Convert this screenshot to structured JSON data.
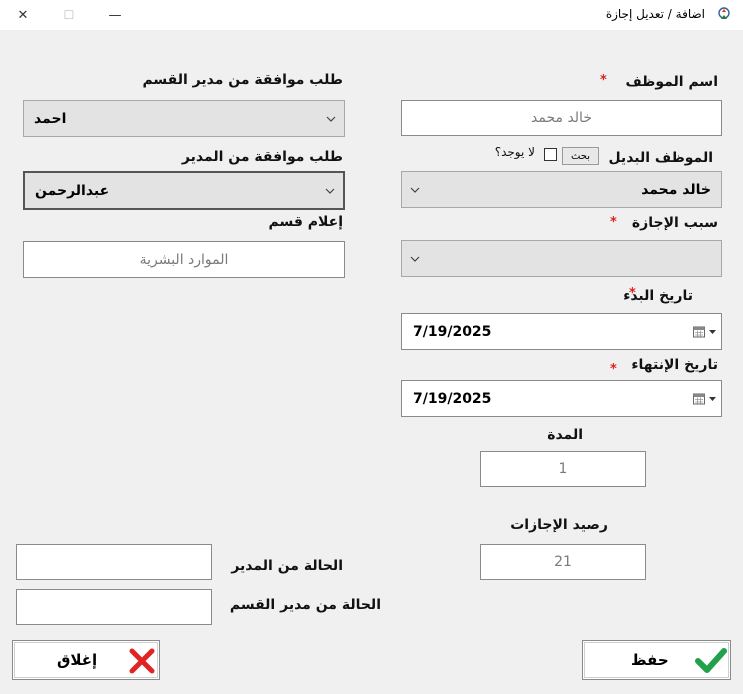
{
  "window": {
    "title": "اضافة / تعديل إجازة",
    "minimize": "—",
    "maximize": "☐",
    "close": "✕"
  },
  "employee_name": {
    "label": "اسم الموظف",
    "value": "خالد محمد"
  },
  "substitute": {
    "label": "الموظف البديل",
    "search_button": "بحث",
    "none_checkbox_label": "لا يوجد؟",
    "selected": "خالد محمد"
  },
  "leave_reason": {
    "label": "سبب الإجازة",
    "selected": ""
  },
  "start_date": {
    "label": "تاريخ البدء",
    "value": "7/19/2025"
  },
  "end_date": {
    "label": "تاريخ الإنتهاء",
    "value": "7/19/2025"
  },
  "duration": {
    "label": "المدة",
    "value": "1"
  },
  "leave_balance": {
    "label": "رصيد الإجازات",
    "value": "21"
  },
  "dept_manager_approval": {
    "label": "طلب موافقة من مدير القسم",
    "selected": "احمد"
  },
  "manager_approval": {
    "label": "طلب موافقة من المدير",
    "selected": "عبدالرحمن"
  },
  "notify_department": {
    "label": "إعلام قسم",
    "value": "الموارد البشرية"
  },
  "status_manager": {
    "label": "الحالة من المدير",
    "value": ""
  },
  "status_dept_manager": {
    "label": "الحالة من مدير القسم",
    "value": ""
  },
  "buttons": {
    "save": "حفظ",
    "close": "إغلاق"
  },
  "required_mark": "*",
  "colors": {
    "required": "#e02020",
    "save_icon": "#22a04a",
    "close_icon": "#e02424"
  }
}
